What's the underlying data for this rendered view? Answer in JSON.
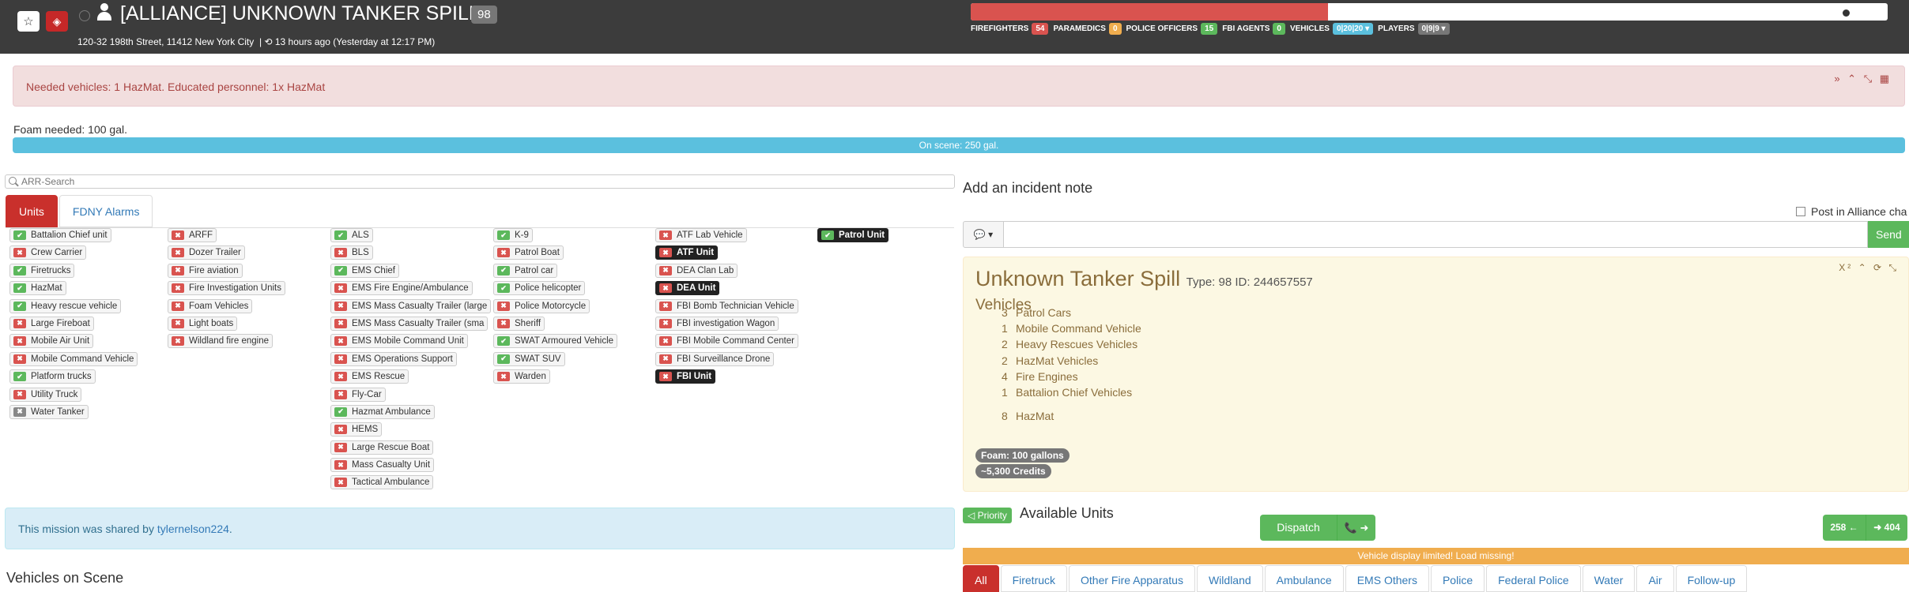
{
  "header": {
    "title": "[ALLIANCE] UNKNOWN TANKER SPILL",
    "mission_badge": "98",
    "address": "120-32 198th Street, 11412 New York City",
    "time": "13 hours ago (Yesterday at 12:17 PM)",
    "progress_fraction": 0.39,
    "stats": [
      {
        "label": "FIREFIGHTERS",
        "value": "54",
        "color": "#d9534f"
      },
      {
        "label": "PARAMEDICS",
        "value": "0",
        "color": "#f0ad4e"
      },
      {
        "label": "POLICE OFFICERS",
        "value": "15",
        "color": "#5cb85c"
      },
      {
        "label": "FBI AGENTS",
        "value": "0",
        "color": "#5cb85c"
      },
      {
        "label": "VEHICLES",
        "value": "0|20|20 ▾",
        "color": "#5bc0de"
      },
      {
        "label": "PLAYERS",
        "value": "0|9|9 ▾",
        "color": "#777777"
      }
    ]
  },
  "alert": {
    "text": "Needed vehicles: 1 HazMat. Educated personnel: 1x HazMat"
  },
  "foam": {
    "needed": "Foam needed: 100 gal.",
    "on_scene": "On scene: 250 gal."
  },
  "search": {
    "placeholder": "ARR-Search"
  },
  "tabs": [
    "Units",
    "FDNY Alarms"
  ],
  "units": [
    {
      "col": 0,
      "name": "Battalion Chief unit",
      "state": "ok"
    },
    {
      "col": 0,
      "name": "Crew Carrier",
      "state": "no"
    },
    {
      "col": 0,
      "name": "Firetrucks",
      "state": "ok"
    },
    {
      "col": 0,
      "name": "HazMat",
      "state": "ok"
    },
    {
      "col": 0,
      "name": "Heavy rescue vehicle",
      "state": "ok"
    },
    {
      "col": 0,
      "name": "Large Fireboat",
      "state": "no"
    },
    {
      "col": 0,
      "name": "Mobile Air Unit",
      "state": "no"
    },
    {
      "col": 0,
      "name": "Mobile Command Vehicle",
      "state": "no"
    },
    {
      "col": 0,
      "name": "Platform trucks",
      "state": "ok"
    },
    {
      "col": 0,
      "name": "Utility Truck",
      "state": "no"
    },
    {
      "col": 0,
      "name": "Water Tanker",
      "state": "nf"
    },
    {
      "col": 1,
      "name": "ARFF",
      "state": "no"
    },
    {
      "col": 1,
      "name": "Dozer Trailer",
      "state": "no"
    },
    {
      "col": 1,
      "name": "Fire aviation",
      "state": "no"
    },
    {
      "col": 1,
      "name": "Fire Investigation Units",
      "state": "no"
    },
    {
      "col": 1,
      "name": "Foam Vehicles",
      "state": "no"
    },
    {
      "col": 1,
      "name": "Light boats",
      "state": "no"
    },
    {
      "col": 1,
      "name": "Wildland fire engine",
      "state": "no"
    },
    {
      "col": 2,
      "name": "ALS",
      "state": "ok"
    },
    {
      "col": 2,
      "name": "BLS",
      "state": "no"
    },
    {
      "col": 2,
      "name": "EMS Chief",
      "state": "ok"
    },
    {
      "col": 2,
      "name": "EMS Fire Engine/Ambulance",
      "state": "no"
    },
    {
      "col": 2,
      "name": "EMS Mass Casualty Trailer (large",
      "state": "no"
    },
    {
      "col": 2,
      "name": "EMS Mass Casualty Trailer (sma",
      "state": "no"
    },
    {
      "col": 2,
      "name": "EMS Mobile Command Unit",
      "state": "no"
    },
    {
      "col": 2,
      "name": "EMS Operations Support",
      "state": "no"
    },
    {
      "col": 2,
      "name": "EMS Rescue",
      "state": "no"
    },
    {
      "col": 2,
      "name": "Fly-Car",
      "state": "no"
    },
    {
      "col": 2,
      "name": "Hazmat Ambulance",
      "state": "ok"
    },
    {
      "col": 2,
      "name": "HEMS",
      "state": "no"
    },
    {
      "col": 2,
      "name": "Large Rescue Boat",
      "state": "no"
    },
    {
      "col": 2,
      "name": "Mass Casualty Unit",
      "state": "no"
    },
    {
      "col": 2,
      "name": "Tactical Ambulance",
      "state": "no"
    },
    {
      "col": 3,
      "name": "K-9",
      "state": "ok"
    },
    {
      "col": 3,
      "name": "Patrol Boat",
      "state": "no"
    },
    {
      "col": 3,
      "name": "Patrol car",
      "state": "ok"
    },
    {
      "col": 3,
      "name": "Police helicopter",
      "state": "ok"
    },
    {
      "col": 3,
      "name": "Police Motorcycle",
      "state": "no"
    },
    {
      "col": 3,
      "name": "Sheriff",
      "state": "no"
    },
    {
      "col": 3,
      "name": "SWAT Armoured Vehicle",
      "state": "ok"
    },
    {
      "col": 3,
      "name": "SWAT SUV",
      "state": "ok"
    },
    {
      "col": 3,
      "name": "Warden",
      "state": "no"
    },
    {
      "col": 4,
      "name": "ATF Lab Vehicle",
      "state": "no"
    },
    {
      "col": 4,
      "name": "ATF Unit",
      "state": "no",
      "selected": true
    },
    {
      "col": 4,
      "name": "DEA Clan Lab",
      "state": "no"
    },
    {
      "col": 4,
      "name": "DEA Unit",
      "state": "no",
      "selected": true
    },
    {
      "col": 4,
      "name": "FBI Bomb Technician Vehicle",
      "state": "no"
    },
    {
      "col": 4,
      "name": "FBI investigation Wagon",
      "state": "no"
    },
    {
      "col": 4,
      "name": "FBI Mobile Command Center",
      "state": "no"
    },
    {
      "col": 4,
      "name": "FBI Surveillance Drone",
      "state": "no"
    },
    {
      "col": 4,
      "name": "FBI Unit",
      "state": "no",
      "selected": true
    },
    {
      "col": 5,
      "name": "Patrol Unit",
      "state": "ok",
      "selected": true
    }
  ],
  "share": {
    "prefix": "This mission was shared by ",
    "user": "tylernelson224",
    "suffix": "."
  },
  "vehicles_on_scene": "Vehicles on Scene",
  "note": {
    "heading": "Add an incident note",
    "alliance_label": "Post in Alliance cha",
    "send": "Send",
    "dropdown": "💬 ▾"
  },
  "mission": {
    "title": "Unknown Tanker Spill",
    "meta": "Type: 98 ID: 244657557",
    "tools": "X² ⌃ ⟳ ⤡",
    "sub": "Vehicles",
    "requirements": [
      {
        "n": "3",
        "label": "Patrol Cars"
      },
      {
        "n": "1",
        "label": "Mobile Command Vehicle"
      },
      {
        "n": "2",
        "label": "Heavy Rescues Vehicles"
      },
      {
        "n": "2",
        "label": "HazMat Vehicles"
      },
      {
        "n": "4",
        "label": "Fire Engines"
      },
      {
        "n": "1",
        "label": "Battalion Chief Vehicles"
      },
      {
        "n": "8",
        "label": "HazMat"
      }
    ],
    "foam_pill": "Foam: 100 gallons",
    "credits_pill": "~5,300 Credits"
  },
  "available": {
    "priority": "◁ Priority",
    "heading": "Available Units",
    "dispatch": "Dispatch",
    "dispatch_next": "📞 ➜",
    "prev": "258 ←",
    "next": "➜ 404"
  },
  "vehicle_limit": "Vehicle display limited! Load missing!",
  "vehicle_tabs": [
    "All",
    "Firetruck",
    "Other Fire Apparatus",
    "Wildland",
    "Ambulance",
    "EMS Others",
    "Police",
    "Federal Police",
    "Water",
    "Air",
    "Follow-up"
  ],
  "alert_tools": "» ⌃ ⤡ ▦",
  "icons": {
    "fav": "star-icon",
    "caution": "caution-icon",
    "user": "user-icon",
    "time": "clock-icon"
  }
}
